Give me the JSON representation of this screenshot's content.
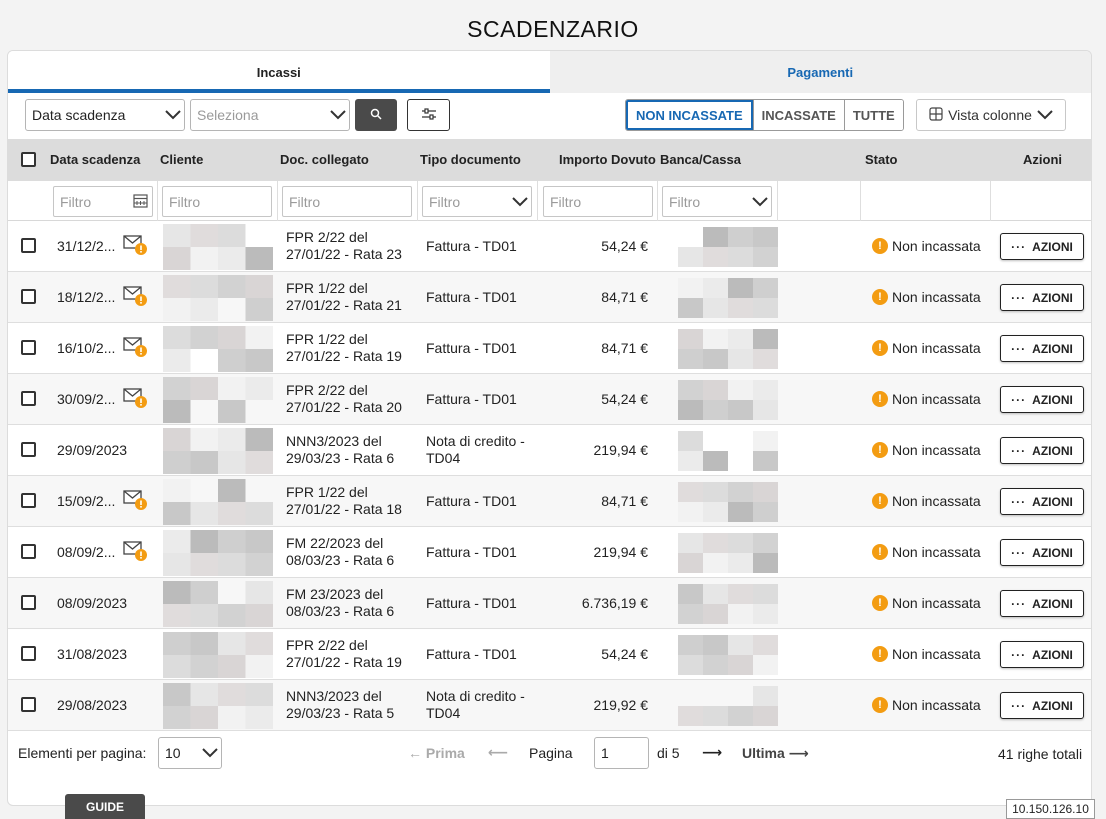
{
  "page": {
    "title": "SCADENZARIO"
  },
  "tabs": [
    {
      "label": "Incassi",
      "active": true
    },
    {
      "label": "Pagamenti",
      "active": false
    }
  ],
  "toolbar": {
    "date_select": "Data scadenza",
    "period_placeholder": "Seleziona",
    "status_filters": [
      "NON INCASSATE",
      "INCASSATE",
      "TUTTE"
    ],
    "active_status": "NON INCASSATE",
    "columns_button": "Vista colonne"
  },
  "table": {
    "headers": [
      "Data scadenza",
      "Cliente",
      "Doc. collegato",
      "Tipo documento",
      "Importo Dovuto",
      "Banca/Cassa",
      "Stato",
      "Azioni"
    ],
    "filter_placeholder": "Filtro",
    "action_label": "AZIONI",
    "rows": [
      {
        "date": "31/12/2...",
        "mail": true,
        "doc_line1": "FPR 2/22 del",
        "doc_line2": "27/01/22 - Rata 23",
        "tipo_line1": "Fattura - TD01",
        "tipo_line2": "",
        "amount": "54,24 €",
        "status": "Non incassata"
      },
      {
        "date": "18/12/2...",
        "mail": true,
        "doc_line1": "FPR 1/22 del",
        "doc_line2": "27/01/22 - Rata 21",
        "tipo_line1": "Fattura - TD01",
        "tipo_line2": "",
        "amount": "84,71 €",
        "status": "Non incassata"
      },
      {
        "date": "16/10/2...",
        "mail": true,
        "doc_line1": "FPR 1/22 del",
        "doc_line2": "27/01/22 - Rata 19",
        "tipo_line1": "Fattura - TD01",
        "tipo_line2": "",
        "amount": "84,71 €",
        "status": "Non incassata"
      },
      {
        "date": "30/09/2...",
        "mail": true,
        "doc_line1": "FPR 2/22 del",
        "doc_line2": "27/01/22 - Rata 20",
        "tipo_line1": "Fattura - TD01",
        "tipo_line2": "",
        "amount": "54,24 €",
        "status": "Non incassata"
      },
      {
        "date": "29/09/2023",
        "mail": false,
        "doc_line1": "NNN3/2023 del",
        "doc_line2": "29/03/23 - Rata 6",
        "tipo_line1": "Nota di credito -",
        "tipo_line2": "TD04",
        "amount": "219,94 €",
        "status": "Non incassata"
      },
      {
        "date": "15/09/2...",
        "mail": true,
        "doc_line1": "FPR 1/22 del",
        "doc_line2": "27/01/22 - Rata 18",
        "tipo_line1": "Fattura - TD01",
        "tipo_line2": "",
        "amount": "84,71 €",
        "status": "Non incassata"
      },
      {
        "date": "08/09/2...",
        "mail": true,
        "doc_line1": "FM 22/2023 del",
        "doc_line2": "08/03/23 - Rata 6",
        "tipo_line1": "Fattura - TD01",
        "tipo_line2": "",
        "amount": "219,94 €",
        "status": "Non incassata"
      },
      {
        "date": "08/09/2023",
        "mail": false,
        "doc_line1": "FM 23/2023 del",
        "doc_line2": "08/03/23 - Rata 6",
        "tipo_line1": "Fattura - TD01",
        "tipo_line2": "",
        "amount": "6.736,19 €",
        "status": "Non incassata"
      },
      {
        "date": "31/08/2023",
        "mail": false,
        "doc_line1": "FPR 2/22 del",
        "doc_line2": "27/01/22 - Rata 19",
        "tipo_line1": "Fattura - TD01",
        "tipo_line2": "",
        "amount": "54,24 €",
        "status": "Non incassata"
      },
      {
        "date": "29/08/2023",
        "mail": false,
        "doc_line1": "NNN3/2023 del",
        "doc_line2": "29/03/23 - Rata 5",
        "tipo_line1": "Nota di credito -",
        "tipo_line2": "TD04",
        "amount": "219,92 €",
        "status": "Non incassata"
      }
    ]
  },
  "pagination": {
    "per_page_label": "Elementi per pagina:",
    "per_page_value": "10",
    "first": "Prima",
    "page_label": "Pagina",
    "current_page": "1",
    "of_pages": "di 5",
    "last": "Ultima",
    "total": "41 righe totali"
  },
  "footer": {
    "guide": "GUIDE",
    "ip": "10.150.126.10"
  },
  "colors": {
    "accent": "#1768b3",
    "warning": "#f39c12",
    "dark_button": "#4a4a4a"
  }
}
